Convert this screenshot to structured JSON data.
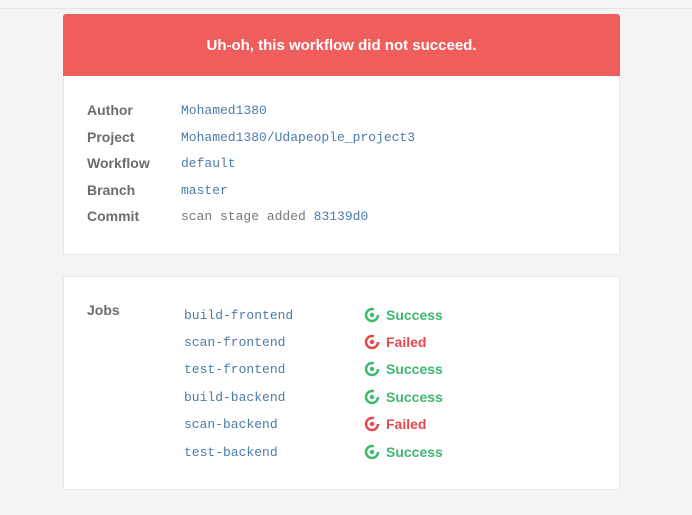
{
  "banner": {
    "title": "Uh-oh, this workflow did not succeed."
  },
  "details": {
    "author_label": "Author",
    "author_value": "Mohamed1380",
    "project_label": "Project",
    "project_value": "Mohamed1380/Udapeople_project3",
    "workflow_label": "Workflow",
    "workflow_value": "default",
    "branch_label": "Branch",
    "branch_value": "master",
    "commit_label": "Commit",
    "commit_message": "scan stage added",
    "commit_hash": "83139d0"
  },
  "jobs": {
    "label": "Jobs",
    "items": [
      {
        "name": "build-frontend",
        "status": "Success"
      },
      {
        "name": "scan-frontend",
        "status": "Failed"
      },
      {
        "name": "test-frontend",
        "status": "Success"
      },
      {
        "name": "build-backend",
        "status": "Success"
      },
      {
        "name": "scan-backend",
        "status": "Failed"
      },
      {
        "name": "test-backend",
        "status": "Success"
      }
    ]
  },
  "colors": {
    "banner": "#ef5d5d",
    "success": "#3eb870",
    "failed": "#e5484d",
    "link": "#4b7ba9"
  },
  "icons": {
    "success": "success-status-icon",
    "failed": "failed-status-icon"
  }
}
